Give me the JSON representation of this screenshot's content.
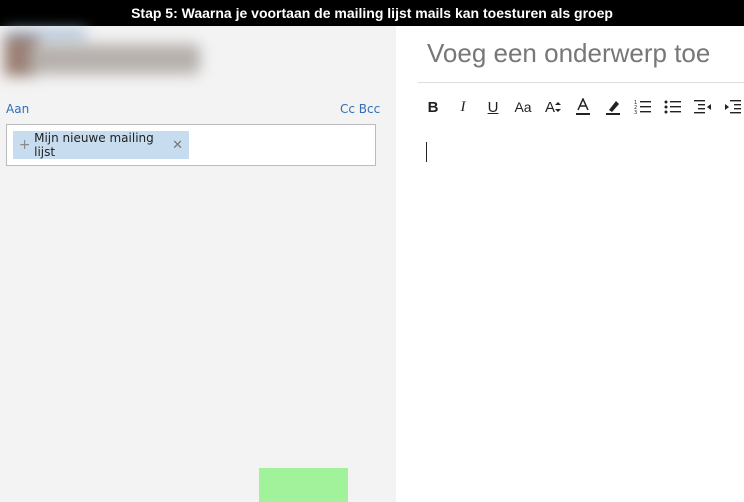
{
  "banner": {
    "text": "Stap 5: Waarna je voortaan de mailing lijst mails kan toesturen als groep"
  },
  "compose": {
    "to_label": "Aan",
    "cc_bcc_label": "Cc Bcc",
    "recipient_chip": {
      "label": "Mijn nieuwe mailing lijst",
      "expand_icon": "plus-icon",
      "remove_icon": "close-icon"
    },
    "subject_placeholder": "Voeg een onderwerp toe"
  },
  "toolbar": {
    "bold_label": "B",
    "italic_label": "I",
    "underline_label": "U",
    "font_label": "Aa",
    "grow_label": "A",
    "icons": [
      "bold-icon",
      "italic-icon",
      "underline-icon",
      "font-size-icon",
      "grow-font-icon",
      "font-color-icon",
      "highlight-icon",
      "numbered-list-icon",
      "bullet-list-icon",
      "decrease-indent-icon",
      "increase-indent-icon"
    ]
  },
  "colors": {
    "accent": "#2f6fb5",
    "chip": "#c7dcee",
    "highlight_box": "#a2f29b",
    "banner": "#000000"
  }
}
